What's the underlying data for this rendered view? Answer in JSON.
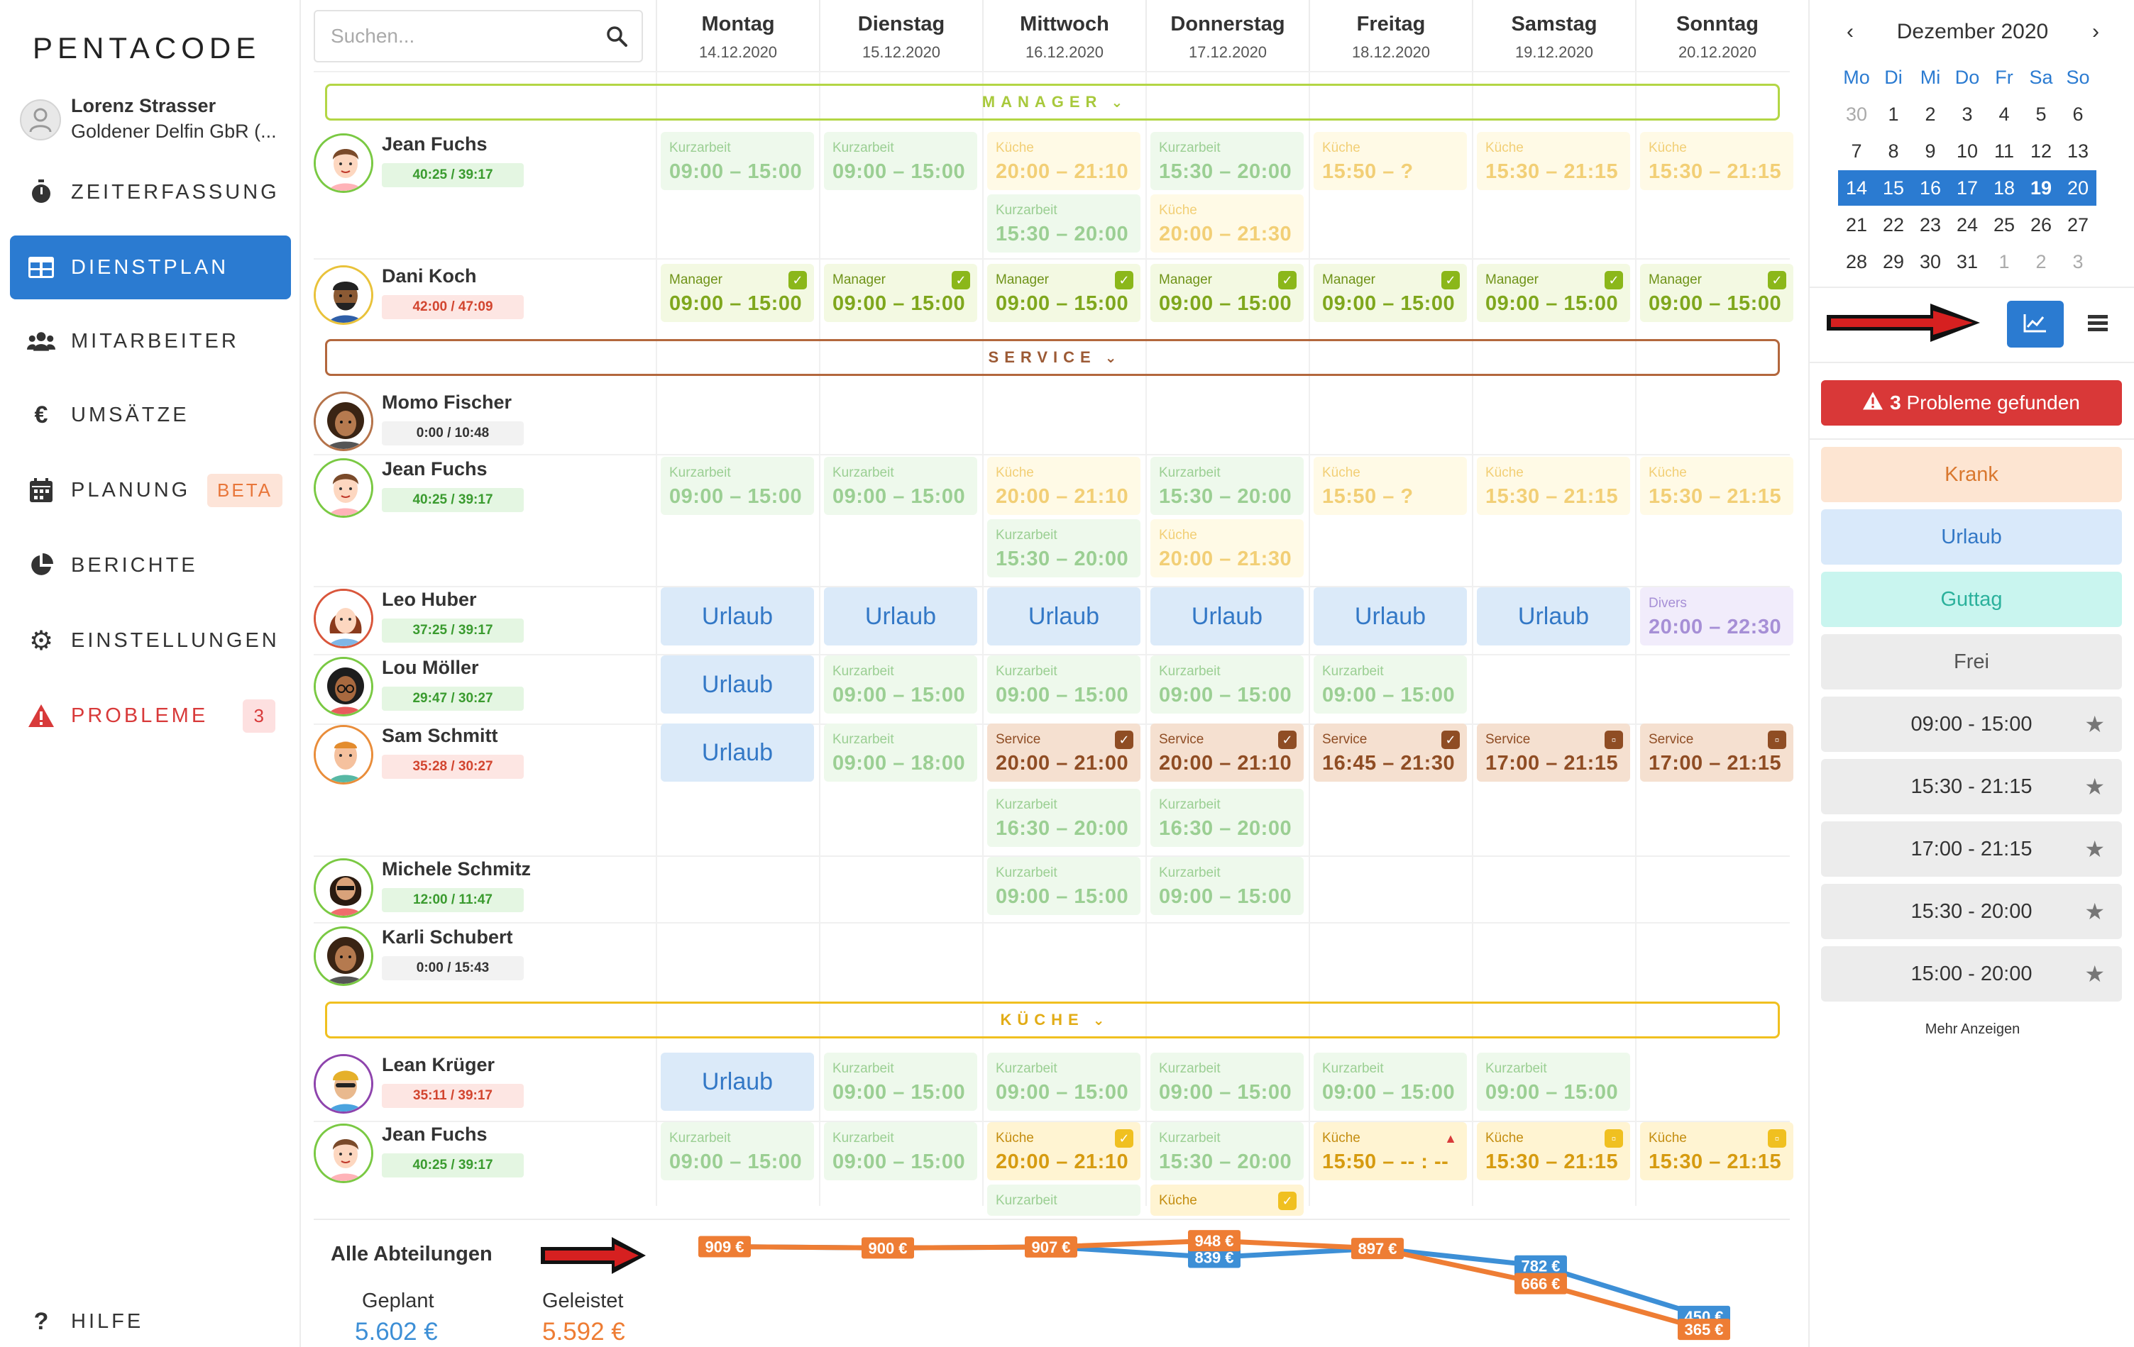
{
  "app": {
    "logo": "PENTACODE"
  },
  "user": {
    "name": "Lorenz Strasser",
    "company": "Goldener Delfin GbR (..."
  },
  "nav": {
    "zeit": "ZEITERFASSUNG",
    "dienst": "DIENSTPLAN",
    "mitarbeiter": "MITARBEITER",
    "umsaetze": "UMSÄTZE",
    "planung": "PLANUNG",
    "planung_badge": "BETA",
    "berichte": "BERICHTE",
    "einstellungen": "EINSTELLUNGEN",
    "probleme": "PROBLEME",
    "probleme_count": "3",
    "hilfe": "HILFE"
  },
  "search": {
    "placeholder": "Suchen..."
  },
  "days": [
    {
      "name": "Montag",
      "date": "14.12.2020"
    },
    {
      "name": "Dienstag",
      "date": "15.12.2020"
    },
    {
      "name": "Mittwoch",
      "date": "16.12.2020"
    },
    {
      "name": "Donnerstag",
      "date": "17.12.2020"
    },
    {
      "name": "Freitag",
      "date": "18.12.2020"
    },
    {
      "name": "Samstag",
      "date": "19.12.2020"
    },
    {
      "name": "Sonntag",
      "date": "20.12.2020"
    }
  ],
  "departments": {
    "manager": "MANAGER",
    "service": "SERVICE",
    "kueche": "KÜCHE"
  },
  "employees": {
    "e1": {
      "name": "Jean Fuchs",
      "hours": "40:25 / 39:17"
    },
    "e2": {
      "name": "Dani Koch",
      "hours": "42:00 / 47:09"
    },
    "e3": {
      "name": "Momo Fischer",
      "hours": "0:00 / 10:48"
    },
    "e4": {
      "name": "Jean Fuchs",
      "hours": "40:25 / 39:17"
    },
    "e5": {
      "name": "Leo Huber",
      "hours": "37:25 / 39:17"
    },
    "e6": {
      "name": "Lou Möller",
      "hours": "29:47 / 30:27"
    },
    "e7": {
      "name": "Sam Schmitt",
      "hours": "35:28 / 30:27"
    },
    "e8": {
      "name": "Michele Schmitz",
      "hours": "12:00 / 11:47"
    },
    "e9": {
      "name": "Karli Schubert",
      "hours": "0:00 / 15:43"
    },
    "e10": {
      "name": "Lean Krüger",
      "hours": "35:11 / 39:17"
    },
    "e11": {
      "name": "Jean Fuchs",
      "hours": "40:25 / 39:17"
    }
  },
  "shift_types": {
    "kurzarbeit": "Kurzarbeit",
    "kueche": "Küche",
    "manager": "Manager",
    "service": "Service",
    "divers": "Divers",
    "urlaub": "Urlaub"
  },
  "times": {
    "t0915": "09:00 – 15:00",
    "t0918": "09:00 – 18:00",
    "t2021": "20:00 – 21:10",
    "t1520": "15:30 – 20:00",
    "t1550q": "15:50 – ?",
    "t1521": "15:30 – 21:15",
    "t2030": "20:00 – 21:30",
    "t2022": "20:00 – 22:30",
    "t2000_2100": "20:00 – 21:00",
    "t1645": "16:45 – 21:30",
    "t1700": "17:00 – 21:15",
    "t1630": "16:30 – 20:00",
    "t1550x": "15:50 – -- : --"
  },
  "summary": {
    "title": "Alle Abteilungen",
    "planned_label": "Geplant",
    "done_label": "Geleistet",
    "planned_value": "5.602 €",
    "done_value": "5.592 €"
  },
  "chart_data": {
    "type": "line",
    "categories": [
      "Montag",
      "Dienstag",
      "Mittwoch",
      "Donnerstag",
      "Freitag",
      "Samstag",
      "Sonntag"
    ],
    "series": [
      {
        "values": [
          909,
          900,
          907,
          839,
          897,
          782,
          450
        ],
        "color": "#3d8fd6"
      },
      {
        "values": [
          909,
          900,
          907,
          948,
          897,
          666,
          365
        ],
        "color": "#ee7d34"
      }
    ],
    "labels_blue": [
      "",
      "",
      "",
      "839 €",
      "",
      "782 €",
      "450 €"
    ],
    "labels_orange": [
      "909 €",
      "900 €",
      "907 €",
      "948 €",
      "897 €",
      "666 €",
      "365 €"
    ]
  },
  "calendar": {
    "month": "Dezember 2020",
    "weekdays": [
      "Mo",
      "Di",
      "Mi",
      "Do",
      "Fr",
      "Sa",
      "So"
    ],
    "weeks": [
      [
        "30",
        "1",
        "2",
        "3",
        "4",
        "5",
        "6"
      ],
      [
        "7",
        "8",
        "9",
        "10",
        "11",
        "12",
        "13"
      ],
      [
        "14",
        "15",
        "16",
        "17",
        "18",
        "19",
        "20"
      ],
      [
        "21",
        "22",
        "23",
        "24",
        "25",
        "26",
        "27"
      ],
      [
        "28",
        "29",
        "30",
        "31",
        "1",
        "2",
        "3"
      ]
    ]
  },
  "right": {
    "problems_count": "3",
    "problems_text": "Probleme gefunden",
    "krank": "Krank",
    "urlaub": "Urlaub",
    "guttag": "Guttag",
    "frei": "Frei",
    "templates": [
      "09:00 - 15:00",
      "15:30 - 21:15",
      "17:00 - 21:15",
      "15:30 - 20:00",
      "15:00 - 20:00"
    ],
    "more": "Mehr Anzeigen"
  },
  "colors": {
    "primary": "#2b7bd1",
    "danger": "#d93838",
    "planned": "#3d8fd6",
    "done": "#ee7d34"
  }
}
